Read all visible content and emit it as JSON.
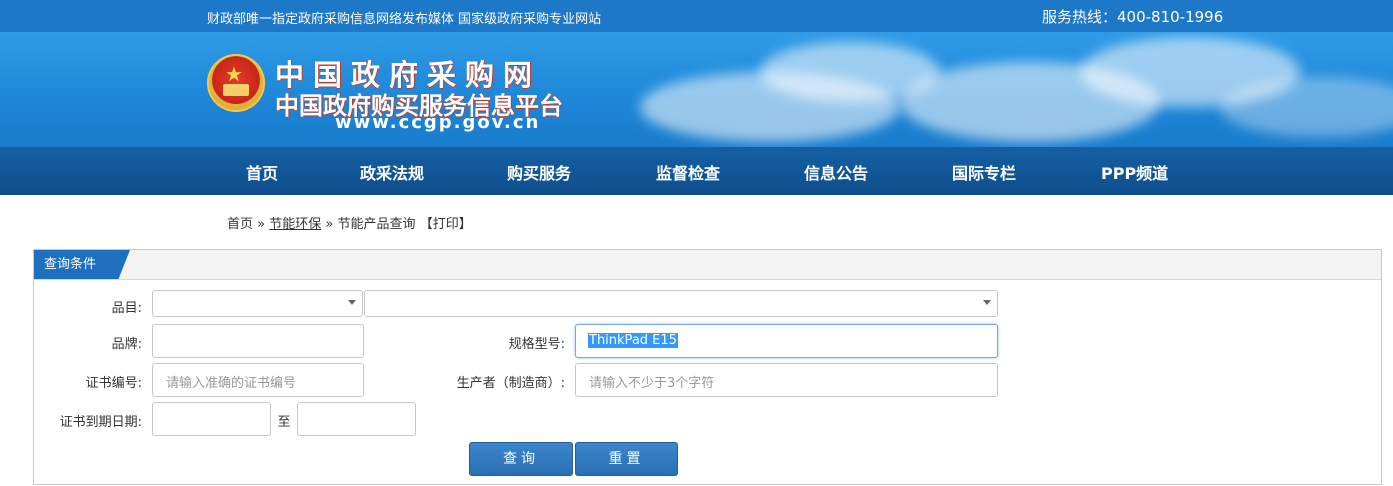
{
  "topbar": {
    "left_text": "财政部唯一指定政府采购信息网络发布媒体 国家级政府采购专业网站",
    "right_text": "服务热线：400-810-1996"
  },
  "header": {
    "title_line1": "中国政府采购网",
    "title_line2": "中国政府购买服务信息平台",
    "url": "www.ccgp.gov.cn"
  },
  "nav": {
    "items": [
      "首页",
      "政采法规",
      "购买服务",
      "监督检查",
      "信息公告",
      "国际专栏",
      "PPP频道"
    ]
  },
  "breadcrumb": {
    "home": "首页",
    "sep": "»",
    "section": "节能环保",
    "page": "节能产品查询",
    "print": "【打印】"
  },
  "panel": {
    "tab_label": "查询条件",
    "fields": {
      "category_label": "品目:",
      "brand_label": "品牌:",
      "model_label": "规格型号:",
      "model_value": "ThinkPad E15",
      "cert_no_label": "证书编号:",
      "cert_no_placeholder": "请输入准确的证书编号",
      "maker_label": "生产者（制造商）:",
      "maker_placeholder": "请输入不少于3个字符",
      "expiry_label": "证书到期日期:",
      "to_label": "至"
    },
    "buttons": {
      "search": "查询",
      "reset": "重置"
    }
  }
}
